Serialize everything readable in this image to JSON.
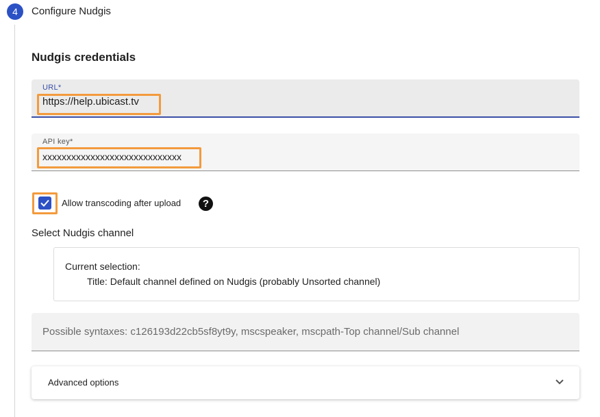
{
  "step": {
    "number": "4",
    "title": "Configure Nudgis"
  },
  "credentials": {
    "title": "Nudgis credentials",
    "url": {
      "label": "URL*",
      "value": "https://help.ubicast.tv"
    },
    "api_key": {
      "label": "API key*",
      "value": "xxxxxxxxxxxxxxxxxxxxxxxxxxxxx"
    }
  },
  "transcoding": {
    "label": "Allow transcoding after upload",
    "checked": true,
    "help_icon": "?"
  },
  "channel": {
    "heading": "Select Nudgis channel",
    "selection_heading": "Current selection:",
    "selection_value": "Title: Default channel defined on Nudgis (probably Unsorted channel)",
    "syntax_placeholder": "Possible syntaxes: c126193d22cb5sf8yt9y, mscspeaker, mscpath-Top channel/Sub channel"
  },
  "advanced": {
    "label": "Advanced options",
    "icon": "chevron-down-icon"
  },
  "colors": {
    "accent": "#2c51c5",
    "highlight": "#f39a3c"
  }
}
